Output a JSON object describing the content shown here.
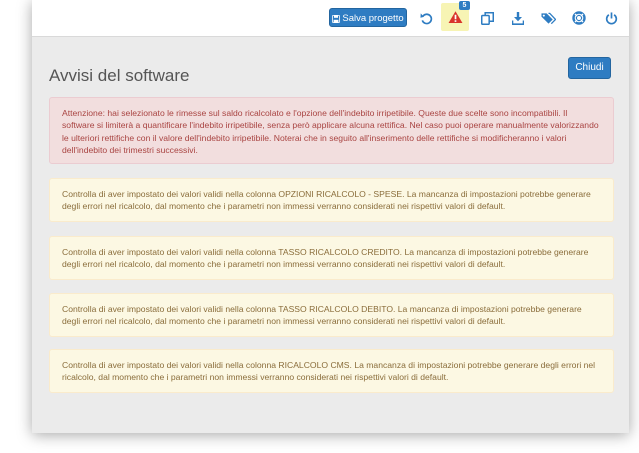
{
  "toolbar": {
    "save_label": "Salva progetto",
    "warning_count": "5",
    "icons": [
      "undo-icon",
      "warning-icon",
      "copy-icon",
      "download-icon",
      "tags-icon",
      "life-ring-icon",
      "power-icon"
    ]
  },
  "colors": {
    "primary": "#2e7cc2",
    "danger_bg": "#f2dede",
    "danger_text": "#a94442",
    "warning_bg": "#fcf8e3",
    "warning_text": "#8a6d3b",
    "highlight": "#f7f4b4"
  },
  "page": {
    "title": "Avvisi del software",
    "close_label": "Chiudi"
  },
  "alerts": {
    "danger": "Attenzione: hai selezionato le rimesse sul saldo ricalcolato e l'opzione dell'indebito irripetibile. Queste due scelte sono incompatibili. Il software si limiterà a quantificare l'indebito irripetibile, senza però applicare alcuna rettifica. Nel caso puoi operare manualmente valorizzando le ulteriori rettifiche con il valore dell'indebito irripetibile. Noterai che in seguito all'inserimento delle rettifiche si modificheranno i valori dell'indebito dei trimestri successivi.",
    "warnings": [
      "Controlla di aver impostato dei valori validi nella colonna OPZIONI RICALCOLO - SPESE. La mancanza di impostazioni potrebbe generare degli errori nel ricalcolo, dal momento che i parametri non immessi verranno considerati nei rispettivi valori di default.",
      "Controlla di aver impostato dei valori validi nella colonna TASSO RICALCOLO CREDITO. La mancanza di impostazioni potrebbe generare degli errori nel ricalcolo, dal momento che i parametri non immessi verranno considerati nei rispettivi valori di default.",
      "Controlla di aver impostato dei valori validi nella colonna TASSO RICALCOLO DEBITO. La mancanza di impostazioni potrebbe generare degli errori nel ricalcolo, dal momento che i parametri non immessi verranno considerati nei rispettivi valori di default.",
      "Controlla di aver impostato dei valori validi nella colonna RICALCOLO CMS. La mancanza di impostazioni potrebbe generare degli errori nel ricalcolo, dal momento che i parametri non immessi verranno considerati nei rispettivi valori di default."
    ]
  }
}
